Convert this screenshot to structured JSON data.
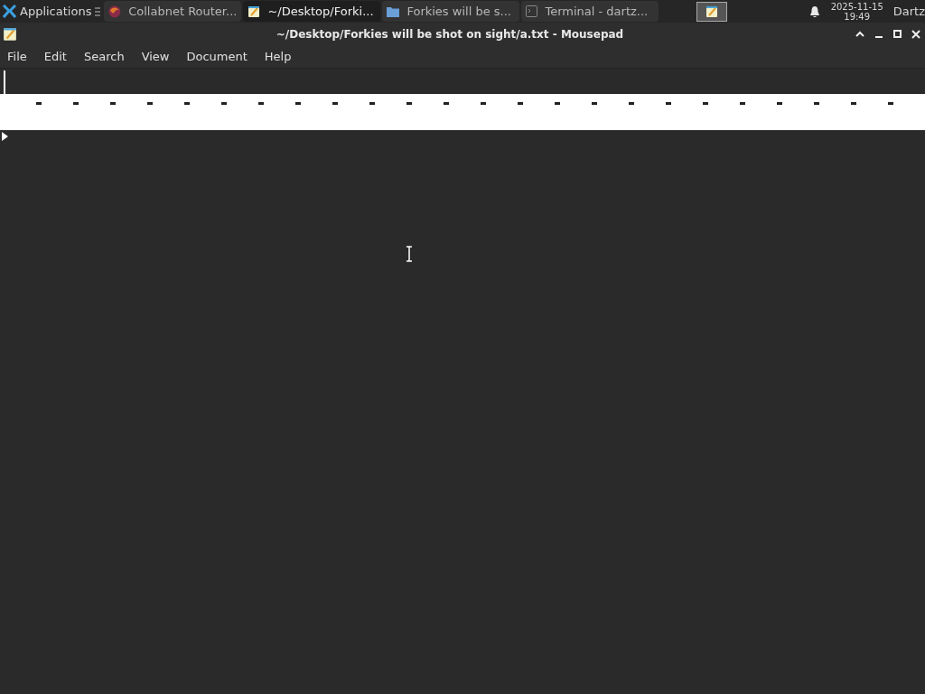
{
  "taskbar": {
    "menu_label": "Applications",
    "tasks": [
      {
        "label": "Collabnet Router...",
        "kind": "browser",
        "selected": false
      },
      {
        "label": "~/Desktop/Forki...",
        "kind": "editor",
        "selected": true
      },
      {
        "label": "Forkies will be s...",
        "kind": "folder",
        "selected": false
      },
      {
        "label": "Terminal - dartz...",
        "kind": "terminal",
        "selected": false
      }
    ],
    "date": "2025-11-15",
    "time": "19:49",
    "user": "Dartz"
  },
  "window": {
    "title": "~/Desktop/Forkies will be shot on sight/a.txt - Mousepad"
  },
  "menu": [
    "File",
    "Edit",
    "Search",
    "View",
    "Document",
    "Help"
  ]
}
